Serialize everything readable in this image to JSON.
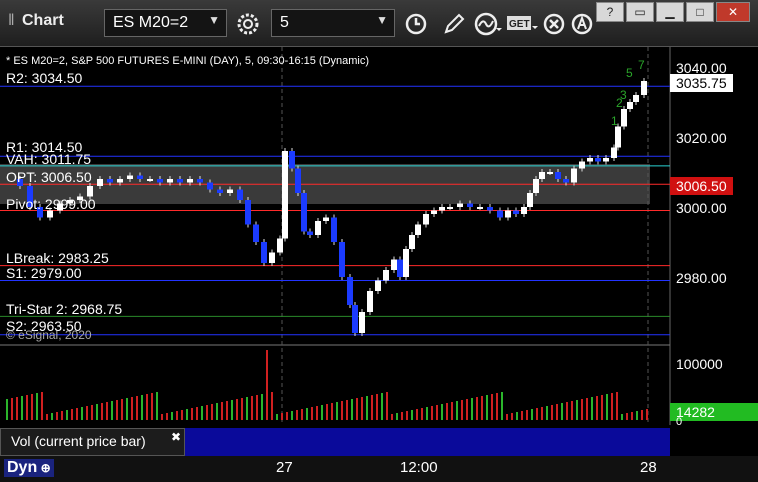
{
  "toolbar": {
    "title": "Chart",
    "symbol": "ES M20=2",
    "interval": "5"
  },
  "chart": {
    "header": "* ES M20=2, S&P 500 FUTURES E-MINI (DAY), 5, 09:30-16:15 (Dynamic)",
    "copyright": "© eSignal, 2020",
    "price_ticks": [
      "3040.00",
      "3020.00",
      "3000.00",
      "2980.00"
    ],
    "last_price": "3035.75",
    "highlight_price": "3006.50",
    "levels": [
      {
        "label": "R2: 3034.50",
        "price": 3034.5,
        "color": "#2233ff"
      },
      {
        "label": "R1: 3014.50",
        "price": 3014.5,
        "color": "#2233ff"
      },
      {
        "label": "VAH: 3011.75",
        "price": 3011.75,
        "color": "#2bd3d3"
      },
      {
        "label": "OPT: 3006.50",
        "price": 3006.5,
        "color": "#ff2a2a"
      },
      {
        "label": "Pivot: 2999.00",
        "price": 2999.0,
        "color": "#ff2a2a"
      },
      {
        "label": "LBreak: 2983.25",
        "price": 2983.25,
        "color": "#ff2a2a"
      },
      {
        "label": "S1: 2979.00",
        "price": 2979.0,
        "color": "#2233ff"
      },
      {
        "label": "Tri-Star 2: 2968.75",
        "price": 2968.75,
        "color": "#2a8a2a"
      },
      {
        "label": "S2: 2963.50",
        "price": 2963.5,
        "color": "#2233ff"
      }
    ],
    "volume": {
      "ticks": [
        "100000",
        "0"
      ],
      "last": "14282",
      "label": "Vol (current price bar)"
    },
    "time_labels": [
      "27",
      "12:00",
      "28"
    ],
    "colors": {
      "up": "#ffffff",
      "down": "#1b3bff",
      "last_tag": "#ffffff",
      "highlight_tag": "#d01010",
      "vol_tag": "#22bb22"
    }
  },
  "bottom": {
    "dyn_label": "Dyn"
  }
}
